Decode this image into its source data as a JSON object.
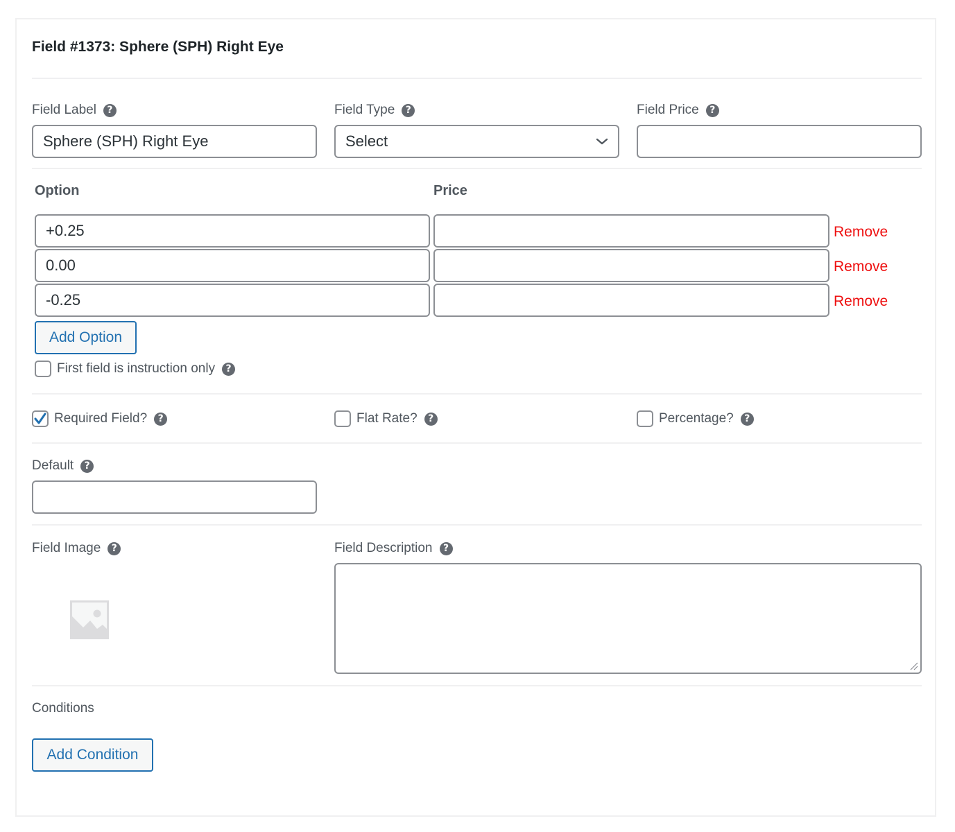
{
  "header": {
    "title": "Field #1373: Sphere (SPH) Right Eye"
  },
  "field_label": {
    "label": "Field Label",
    "value": "Sphere (SPH) Right Eye"
  },
  "field_type": {
    "label": "Field Type",
    "selected": "Select"
  },
  "field_price": {
    "label": "Field Price",
    "value": ""
  },
  "options": {
    "option_header": "Option",
    "price_header": "Price",
    "remove_label": "Remove",
    "rows": [
      {
        "option": "+0.25",
        "price": ""
      },
      {
        "option": "0.00",
        "price": ""
      },
      {
        "option": "-0.25",
        "price": ""
      }
    ],
    "add_option_label": "Add Option",
    "instruction_only": {
      "label": "First field is instruction only",
      "checked": false
    }
  },
  "flags": {
    "required": {
      "label": "Required Field?",
      "checked": true
    },
    "flat_rate": {
      "label": "Flat Rate?",
      "checked": false
    },
    "percentage": {
      "label": "Percentage?",
      "checked": false
    }
  },
  "default": {
    "label": "Default",
    "value": ""
  },
  "field_image": {
    "label": "Field Image",
    "icon": "image-placeholder-icon"
  },
  "field_description": {
    "label": "Field Description",
    "value": ""
  },
  "conditions": {
    "label": "Conditions",
    "add_condition_label": "Add Condition"
  },
  "icons": {
    "help": "?"
  },
  "colors": {
    "accent": "#2271b1",
    "remove": "#ee1010",
    "border": "#8c8f94",
    "divider": "#f0f0f1"
  }
}
